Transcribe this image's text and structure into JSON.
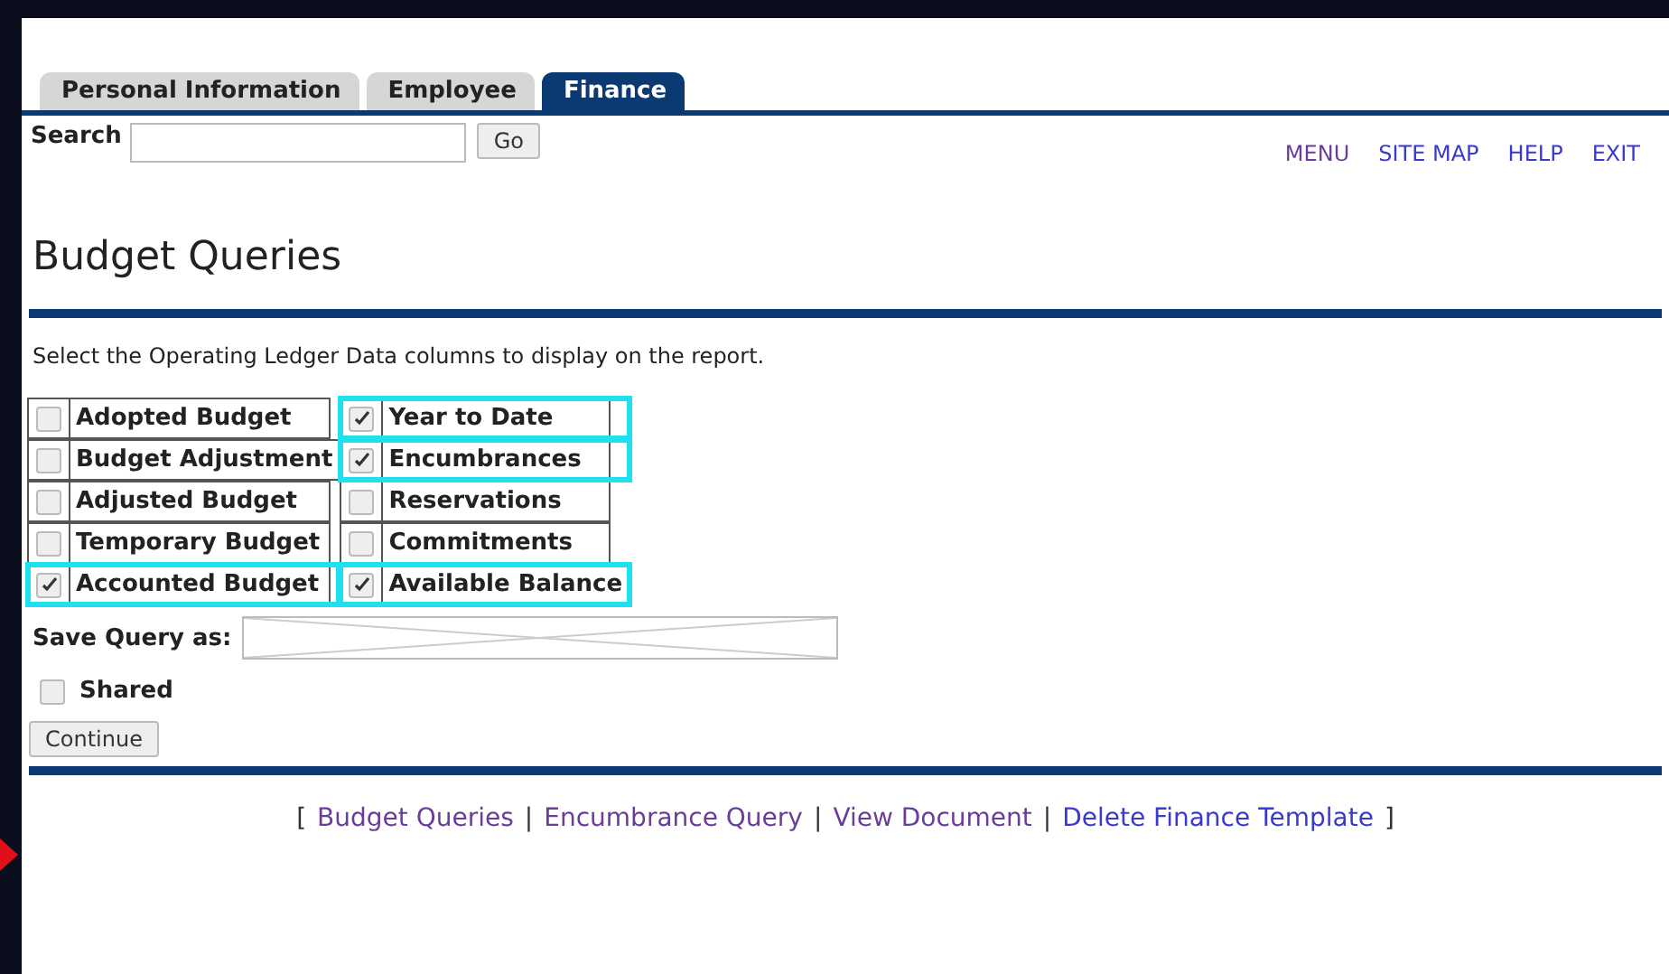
{
  "tabs": [
    {
      "label": "Personal Information",
      "selected": false
    },
    {
      "label": "Employee",
      "selected": false
    },
    {
      "label": "Finance",
      "selected": true
    }
  ],
  "search": {
    "label": "Search",
    "button": "Go"
  },
  "nav_links": [
    {
      "label": "MENU",
      "visited": true
    },
    {
      "label": "SITE MAP",
      "visited": false
    },
    {
      "label": "HELP",
      "visited": false
    },
    {
      "label": "EXIT",
      "visited": false
    }
  ],
  "page_title": "Budget Queries",
  "instructions": "Select the Operating Ledger Data columns to display on the report.",
  "columns_grid": [
    [
      {
        "label": "Adopted Budget",
        "checked": false,
        "highlighted": false
      },
      {
        "label": "Year to Date",
        "checked": true,
        "highlighted": true
      }
    ],
    [
      {
        "label": "Budget Adjustment",
        "checked": false,
        "highlighted": false
      },
      {
        "label": "Encumbrances",
        "checked": true,
        "highlighted": true
      }
    ],
    [
      {
        "label": "Adjusted Budget",
        "checked": false,
        "highlighted": false
      },
      {
        "label": "Reservations",
        "checked": false,
        "highlighted": false
      }
    ],
    [
      {
        "label": "Temporary Budget",
        "checked": false,
        "highlighted": false
      },
      {
        "label": "Commitments",
        "checked": false,
        "highlighted": false
      }
    ],
    [
      {
        "label": "Accounted Budget",
        "checked": true,
        "highlighted": true
      },
      {
        "label": "Available Balance",
        "checked": true,
        "highlighted": true
      }
    ]
  ],
  "save_query": {
    "label": "Save Query as:"
  },
  "shared": {
    "label": "Shared",
    "checked": false
  },
  "continue_button": "Continue",
  "footer": [
    {
      "kind": "bracket",
      "text": "["
    },
    {
      "kind": "link",
      "text": "Budget Queries",
      "visited": true
    },
    {
      "kind": "separator",
      "text": "|"
    },
    {
      "kind": "link",
      "text": "Encumbrance Query",
      "visited": true
    },
    {
      "kind": "separator",
      "text": "|"
    },
    {
      "kind": "link",
      "text": "View Document",
      "visited": true
    },
    {
      "kind": "separator",
      "text": "|"
    },
    {
      "kind": "link",
      "text": "Delete Finance Template",
      "visited": false
    },
    {
      "kind": "bracket",
      "text": "]"
    }
  ]
}
